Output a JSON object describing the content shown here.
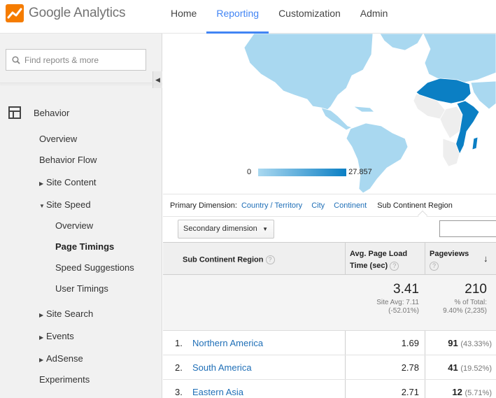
{
  "header": {
    "logo_text": "Google Analytics",
    "nav": [
      {
        "label": "Home",
        "active": false
      },
      {
        "label": "Reporting",
        "active": true
      },
      {
        "label": "Customization",
        "active": false
      },
      {
        "label": "Admin",
        "active": false
      }
    ],
    "accent": "#4285f4"
  },
  "sidebar": {
    "search_placeholder": "Find reports & more",
    "section": "Behavior",
    "items": {
      "overview": "Overview",
      "behavior_flow": "Behavior Flow",
      "site_content": "Site Content",
      "site_speed": "Site Speed",
      "speed_overview": "Overview",
      "page_timings": "Page Timings",
      "speed_suggestions": "Speed Suggestions",
      "user_timings": "User Timings",
      "site_search": "Site Search",
      "events": "Events",
      "adsense": "AdSense",
      "experiments": "Experiments"
    }
  },
  "map": {
    "legend_min": "0",
    "legend_max": "27.857",
    "colors": {
      "low": "#a9d8f0",
      "high": "#0b7fc4",
      "none": "#eeeeee"
    }
  },
  "dimensions": {
    "label": "Primary Dimension:",
    "options": [
      "Country / Territory",
      "City",
      "Continent"
    ],
    "current": "Sub Continent Region"
  },
  "secondary_dimension": "Secondary dimension",
  "table": {
    "col_region": "Sub Continent Region",
    "col_load_1": "Avg. Page Load",
    "col_load_2": "Time (sec)",
    "col_pageviews": "Pageviews",
    "totals": {
      "load": "3.41",
      "load_sub_1": "Site Avg: 7.11",
      "load_sub_2": "(-52.01%)",
      "pageviews": "210",
      "pv_sub_1": "% of Total:",
      "pv_sub_2": "9.40% (2,235)"
    },
    "rows": [
      {
        "idx": "1.",
        "name": "Northern America",
        "load": "1.69",
        "pv": "91",
        "pct": "(43.33%)"
      },
      {
        "idx": "2.",
        "name": "South America",
        "load": "2.78",
        "pv": "41",
        "pct": "(19.52%)"
      },
      {
        "idx": "3.",
        "name": "Eastern Asia",
        "load": "2.71",
        "pv": "12",
        "pct": "(5.71%)"
      }
    ]
  }
}
